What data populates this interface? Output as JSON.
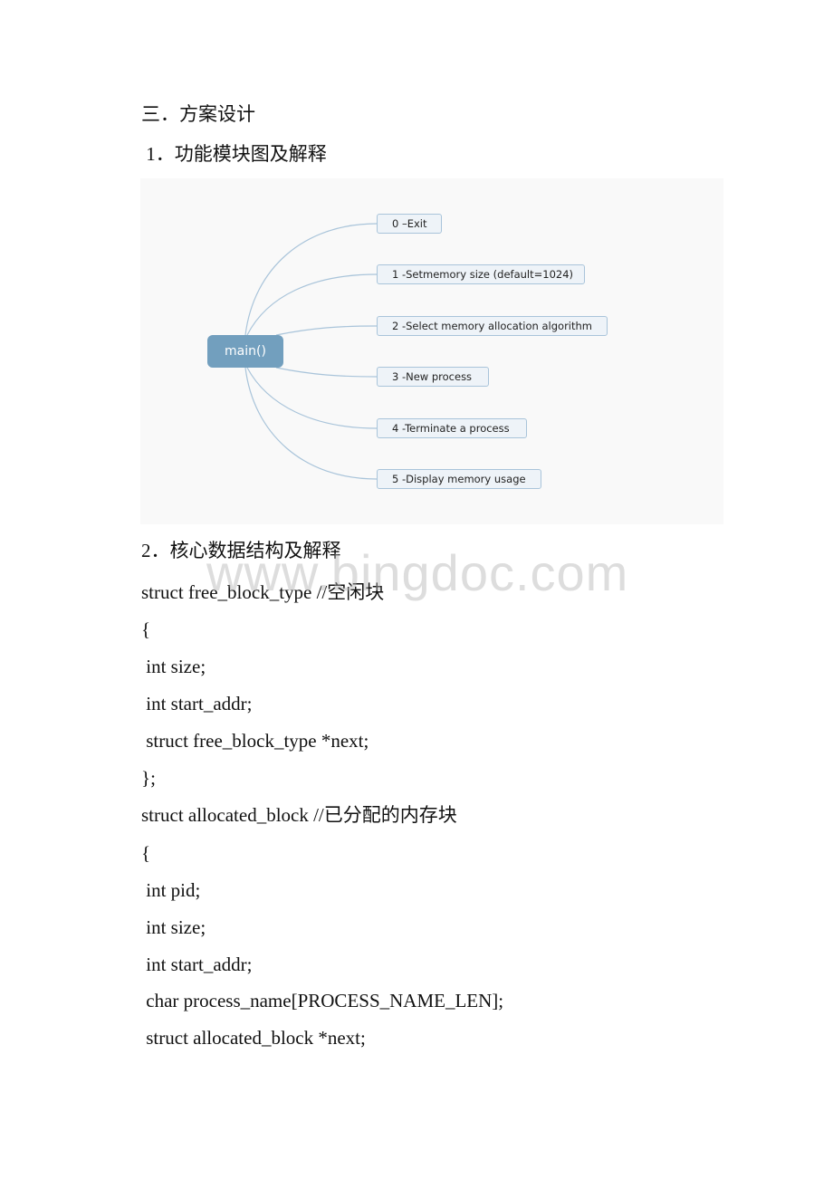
{
  "headings": {
    "section": "三．方案设计",
    "sub1": " 1．功能模块图及解释",
    "sub2": "2．核心数据结构及解释"
  },
  "diagram": {
    "root": "main()",
    "nodes": [
      "0 –Exit",
      "1 -Setmemory size (default=1024)",
      "2 -Select memory allocation algorithm",
      "3 -New process",
      "4 -Terminate a process",
      "5 -Display memory usage"
    ],
    "colors": {
      "root_fill": "#729fbe",
      "node_fill": "#eef3f8",
      "node_border": "#a9c4da",
      "connector": "#a9c4da",
      "background": "#f9f9f9"
    }
  },
  "code": [
    "struct free_block_type //空闲块",
    "{",
    " int size;",
    " int start_addr;",
    " struct free_block_type *next;",
    "};",
    "struct allocated_block //已分配的内存块",
    "{",
    " int pid;",
    " int size;",
    " int start_addr;",
    " char process_name[PROCESS_NAME_LEN];",
    " struct allocated_block *next;"
  ],
  "watermark": "www.bingdoc.com"
}
